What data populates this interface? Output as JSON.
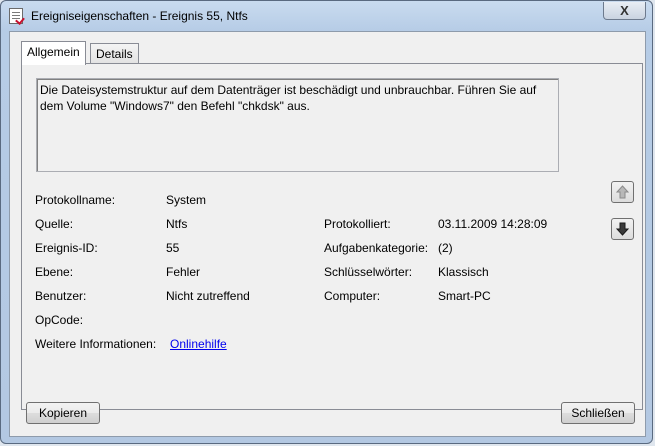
{
  "window": {
    "title": "Ereigniseigenschaften - Ereignis 55, Ntfs",
    "close_glyph": "X"
  },
  "tabs": [
    {
      "label": "Allgemein",
      "active": true
    },
    {
      "label": "Details",
      "active": false
    }
  ],
  "description": "Die Dateisystemstruktur auf dem Datenträger ist beschädigt und unbrauchbar. Führen Sie auf dem Volume \"Windows7\" den Befehl \"chkdsk\" aus.",
  "fields": {
    "protokollname": {
      "label": "Protokollname:",
      "value": "System"
    },
    "quelle": {
      "label": "Quelle:",
      "value": "Ntfs"
    },
    "ereignis_id": {
      "label": "Ereignis-ID:",
      "value": "55"
    },
    "ebene": {
      "label": "Ebene:",
      "value": "Fehler"
    },
    "benutzer": {
      "label": "Benutzer:",
      "value": "Nicht zutreffend"
    },
    "opcode": {
      "label": "OpCode:",
      "value": ""
    },
    "weitere": {
      "label": "Weitere Informationen:",
      "link": "Onlinehilfe"
    },
    "protokolliert": {
      "label": "Protokolliert:",
      "value": "03.11.2009 14:28:09"
    },
    "aufgabenkategorie": {
      "label": "Aufgabenkategorie:",
      "value": "(2)"
    },
    "schluesselwoerter": {
      "label": "Schlüsselwörter:",
      "value": "Klassisch"
    },
    "computer": {
      "label": "Computer:",
      "value": "Smart-PC"
    }
  },
  "buttons": {
    "copy": "Kopieren",
    "close": "Schließen"
  },
  "icons": {
    "up": "arrow-up-icon",
    "down": "arrow-down-icon"
  },
  "colors": {
    "link": "#0000ee",
    "titlebar": "#c9dbef"
  }
}
